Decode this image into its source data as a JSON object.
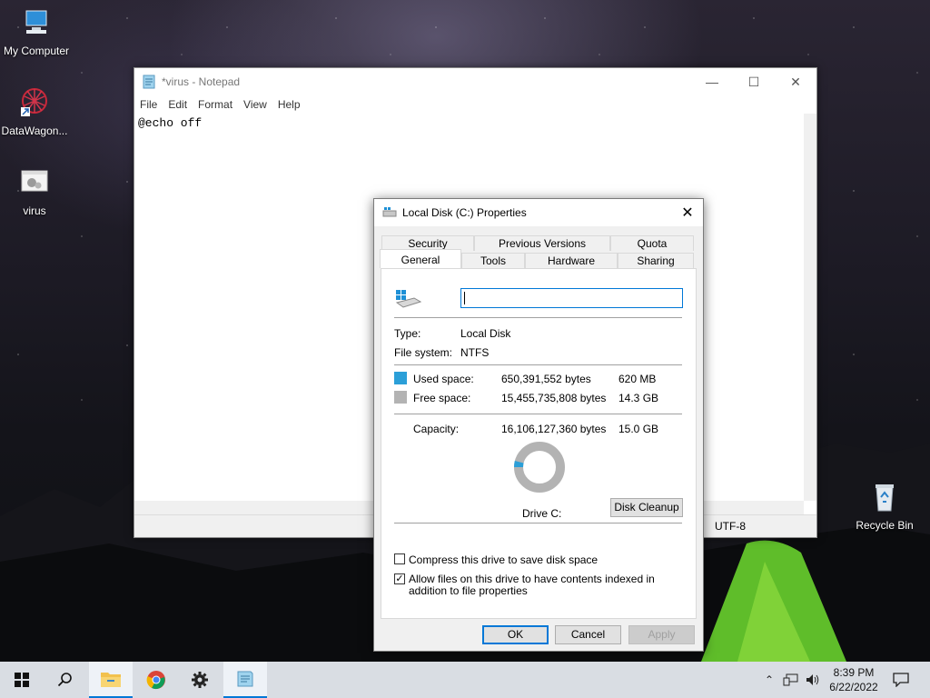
{
  "desktop": {
    "icons": [
      {
        "label": "My Computer"
      },
      {
        "label": "DataWagon..."
      },
      {
        "label": "virus"
      },
      {
        "label": "Recycle Bin"
      }
    ]
  },
  "notepad": {
    "title": "*virus - Notepad",
    "menu": [
      "File",
      "Edit",
      "Format",
      "View",
      "Help"
    ],
    "content": "@echo off",
    "status_encoding": "UTF-8"
  },
  "dialog": {
    "title": "Local Disk (C:) Properties",
    "tabs_top": [
      "Security",
      "Previous Versions",
      "Quota"
    ],
    "tabs_bottom": [
      "General",
      "Tools",
      "Hardware",
      "Sharing"
    ],
    "active_tab": "General",
    "name_value": "",
    "type_label": "Type:",
    "type_value": "Local Disk",
    "fs_label": "File system:",
    "fs_value": "NTFS",
    "used_label": "Used space:",
    "used_bytes": "650,391,552 bytes",
    "used_size": "620 MB",
    "free_label": "Free space:",
    "free_bytes": "15,455,735,808 bytes",
    "free_size": "14.3 GB",
    "capacity_label": "Capacity:",
    "capacity_bytes": "16,106,127,360 bytes",
    "capacity_size": "15.0 GB",
    "drive_label": "Drive C:",
    "used_fraction": 0.04,
    "colors": {
      "used": "#2b9fd8",
      "free": "#b3b3b3"
    },
    "disk_cleanup_label": "Disk Cleanup",
    "compress_label": "Compress this drive to save disk space",
    "compress_checked": false,
    "index_label": "Allow files on this drive to have contents indexed in addition to file properties",
    "index_checked": true,
    "ok_label": "OK",
    "cancel_label": "Cancel",
    "apply_label": "Apply"
  },
  "taskbar": {
    "time": "8:39 PM",
    "date": "6/22/2022"
  }
}
